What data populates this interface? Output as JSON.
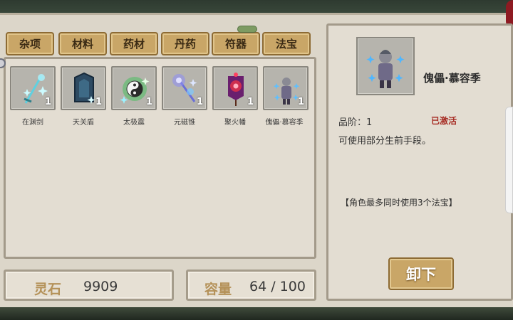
{
  "tabs": [
    {
      "label": "杂项"
    },
    {
      "label": "材料"
    },
    {
      "label": "药材"
    },
    {
      "label": "丹药"
    },
    {
      "label": "符器"
    },
    {
      "label": "法宝"
    }
  ],
  "items": [
    {
      "name": "在渊剑",
      "count": "1",
      "icon": "sword-icon"
    },
    {
      "name": "天关盾",
      "count": "1",
      "icon": "shield-icon"
    },
    {
      "name": "太极震",
      "count": "1",
      "icon": "taiji-icon"
    },
    {
      "name": "元磁锥",
      "count": "1",
      "icon": "cone-icon"
    },
    {
      "name": "聚火幡",
      "count": "1",
      "icon": "banner-icon"
    },
    {
      "name": "傀儡·慕容季",
      "count": "1",
      "icon": "puppet-icon"
    }
  ],
  "stats": {
    "spirit_stone_label": "灵石",
    "spirit_stone_value": "9909",
    "capacity_label": "容量",
    "capacity_value": "64 / 100"
  },
  "detail": {
    "title": "傀儡·慕容季",
    "grade": "品阶：1",
    "status": "已激活",
    "description": "可使用部分生前手段。",
    "note": "【角色最多同时使用3个法宝】",
    "unequip_label": "卸下"
  },
  "colors": {
    "tab_gold": "#c9a667",
    "panel_bg": "#e3ddd2",
    "status_red": "#a62a22",
    "label_gold": "#b49158"
  }
}
